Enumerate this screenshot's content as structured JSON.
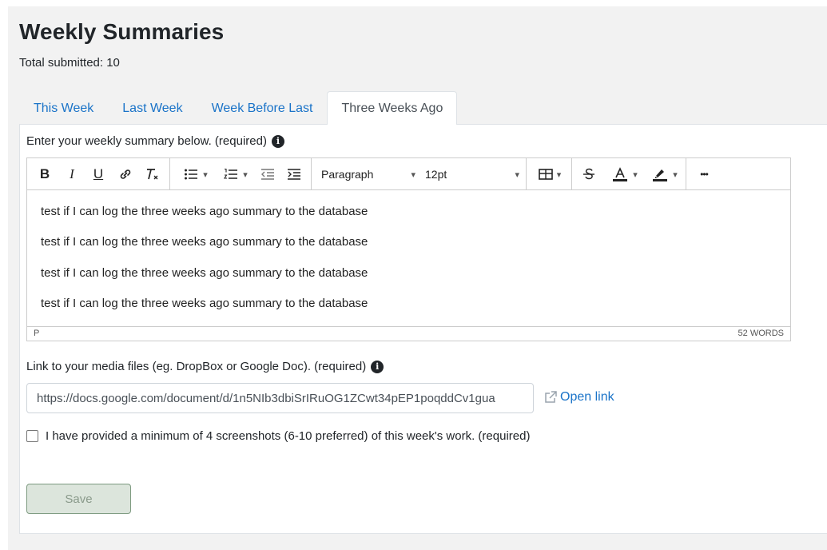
{
  "header": {
    "title": "Weekly Summaries",
    "total_label": "Total submitted: 10"
  },
  "tabs": [
    {
      "label": "This Week",
      "active": false
    },
    {
      "label": "Last Week",
      "active": false
    },
    {
      "label": "Week Before Last",
      "active": false
    },
    {
      "label": "Three Weeks Ago",
      "active": true
    }
  ],
  "summary": {
    "label": "Enter your weekly summary below. (required)",
    "info_glyph": "i",
    "toolbar": {
      "bold": "B",
      "italic": "I",
      "underline": "U",
      "block_format": "Paragraph",
      "font_size": "12pt",
      "more": "•••"
    },
    "paragraphs": [
      "test if I can log the three weeks ago summary to the database",
      "test if I can log the three weeks ago summary to the database",
      "test if I can log the three weeks ago summary to the database",
      "test if I can log the three weeks ago summary to the database"
    ],
    "status_path": "P",
    "word_count": "52 WORDS"
  },
  "media": {
    "label": "Link to your media files (eg. DropBox or Google Doc). (required)",
    "value": "https://docs.google.com/document/d/1n5NIb3dbiSrIRuOG1ZCwt34pEP1poqddCv1gua",
    "open_link_label": "Open link"
  },
  "screenshots": {
    "label": "I have provided a minimum of 4 screenshots (6-10 preferred) of this week's work. (required)",
    "checked": false
  },
  "save_label": "Save",
  "colors": {
    "link": "#1a73c8",
    "save_bg": "#dce5dc",
    "save_border": "#7d9a80",
    "panel_bg": "#f2f2f2"
  }
}
